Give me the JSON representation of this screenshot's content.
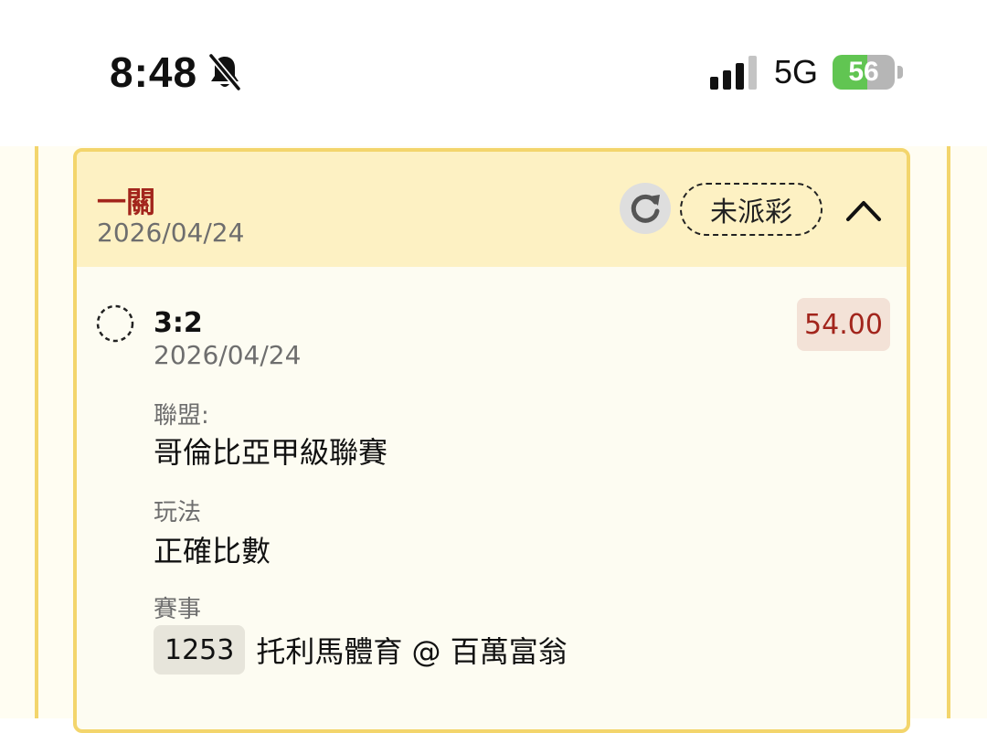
{
  "status_bar": {
    "time": "8:48",
    "network": "5G",
    "battery_level": "56"
  },
  "card": {
    "title": "一關",
    "date": "2026/04/24",
    "status": "未派彩"
  },
  "bet": {
    "selection": "3:2",
    "date": "2026/04/24",
    "odds": "54.00",
    "league_label": "聯盟:",
    "league": "哥倫比亞甲級聯賽",
    "play_label": "玩法",
    "play": "正確比數",
    "match_label": "賽事",
    "match_id": "1253",
    "match_name": "托利馬體育 @ 百萬富翁"
  },
  "colors": {
    "accent": "#a2251c",
    "card_border": "#f3d56c",
    "header_bg": "#fdf1c3",
    "battery": "#61c552"
  }
}
